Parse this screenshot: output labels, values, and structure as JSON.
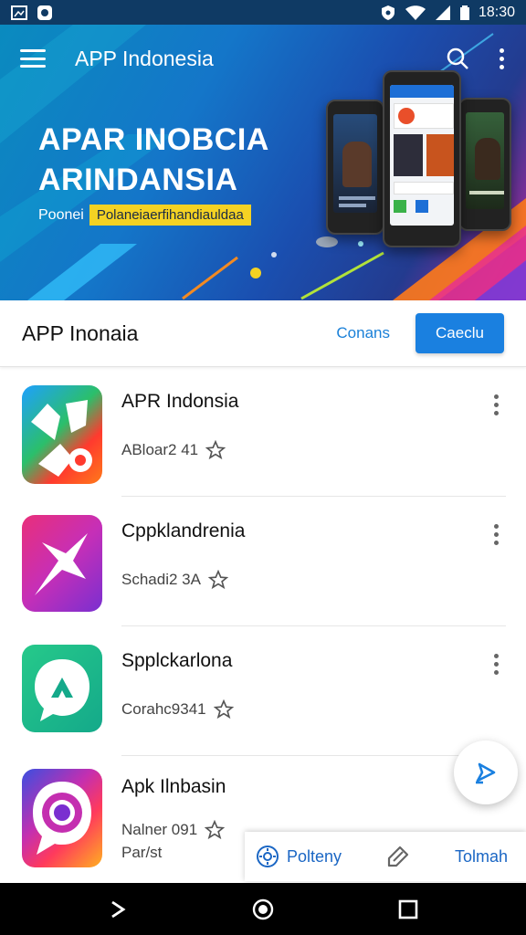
{
  "status_bar": {
    "time": "18:30",
    "icons": [
      "gallery-icon",
      "notification-app-icon",
      "shield-icon",
      "wifi-icon",
      "signal-icon",
      "battery-icon"
    ]
  },
  "header": {
    "app_title": "APP Indonesia",
    "icons": [
      "menu-icon",
      "search-icon",
      "more-vert-icon"
    ]
  },
  "hero": {
    "heading_line1": "APAR INOBCIA",
    "heading_line2": "ARINDANSIA",
    "sub_lead": "Poonei",
    "sub_tag": "Polaneiaerfihandiauldaa",
    "colors": {
      "bg_start": "#0a8bbf",
      "bg_end": "#c0279e",
      "tag": "#f4d223"
    }
  },
  "section": {
    "title": "APP Inonaia",
    "link_label": "Conans",
    "button_label": "Caeclu"
  },
  "apps": [
    {
      "name": "APR Indonsia",
      "meta": "ABloar2 41",
      "icon": "messenger-app-icon"
    },
    {
      "name": "Cppklandrenia",
      "meta": "Schadi2 3A",
      "icon": "plane-app-icon"
    },
    {
      "name": "Spplckarlona",
      "meta": "Corahc9341",
      "icon": "chat-app-icon"
    },
    {
      "name": "Apk Ilnbasin",
      "meta": "Nalner 091",
      "meta2": "Par/st",
      "icon": "camera-chat-app-icon"
    }
  ],
  "fab": {
    "icon": "send-icon"
  },
  "action_card": {
    "left_label": "Polteny",
    "right_label": "Tolmah",
    "icons": [
      "gear-icon",
      "tag-icon"
    ]
  },
  "nav": {
    "icons": [
      "back-icon",
      "home-icon",
      "recents-icon"
    ]
  },
  "accent_color": "#1a80e0"
}
